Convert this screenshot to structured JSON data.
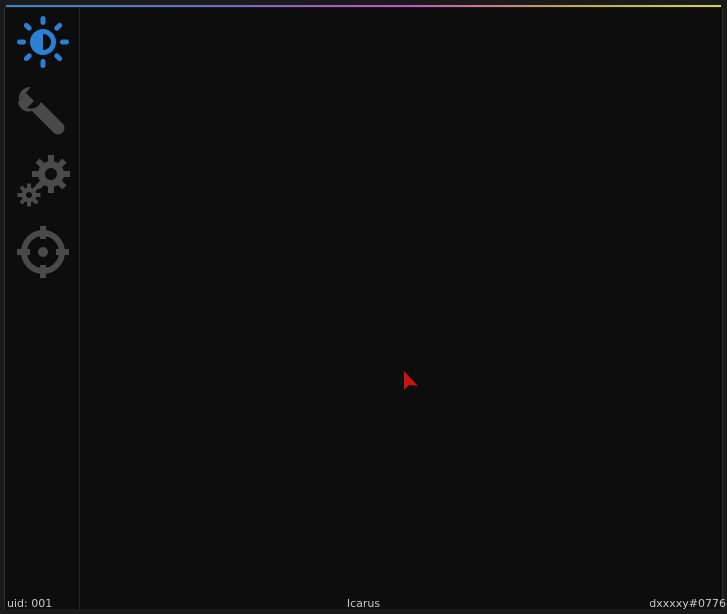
{
  "colors": {
    "accent": "#2b7fd4",
    "icon_inactive": "#4a4a4a",
    "background": "#0d0d0d",
    "cursor": "#cc1111"
  },
  "sidebar": {
    "items": [
      {
        "icon": "brightness-icon",
        "active": true
      },
      {
        "icon": "wrench-icon",
        "active": false
      },
      {
        "icon": "gears-icon",
        "active": false
      },
      {
        "icon": "crosshair-icon",
        "active": false
      }
    ]
  },
  "status": {
    "uid": "uid: 001",
    "name": "Icarus",
    "id": "dxxxxy#0776"
  }
}
